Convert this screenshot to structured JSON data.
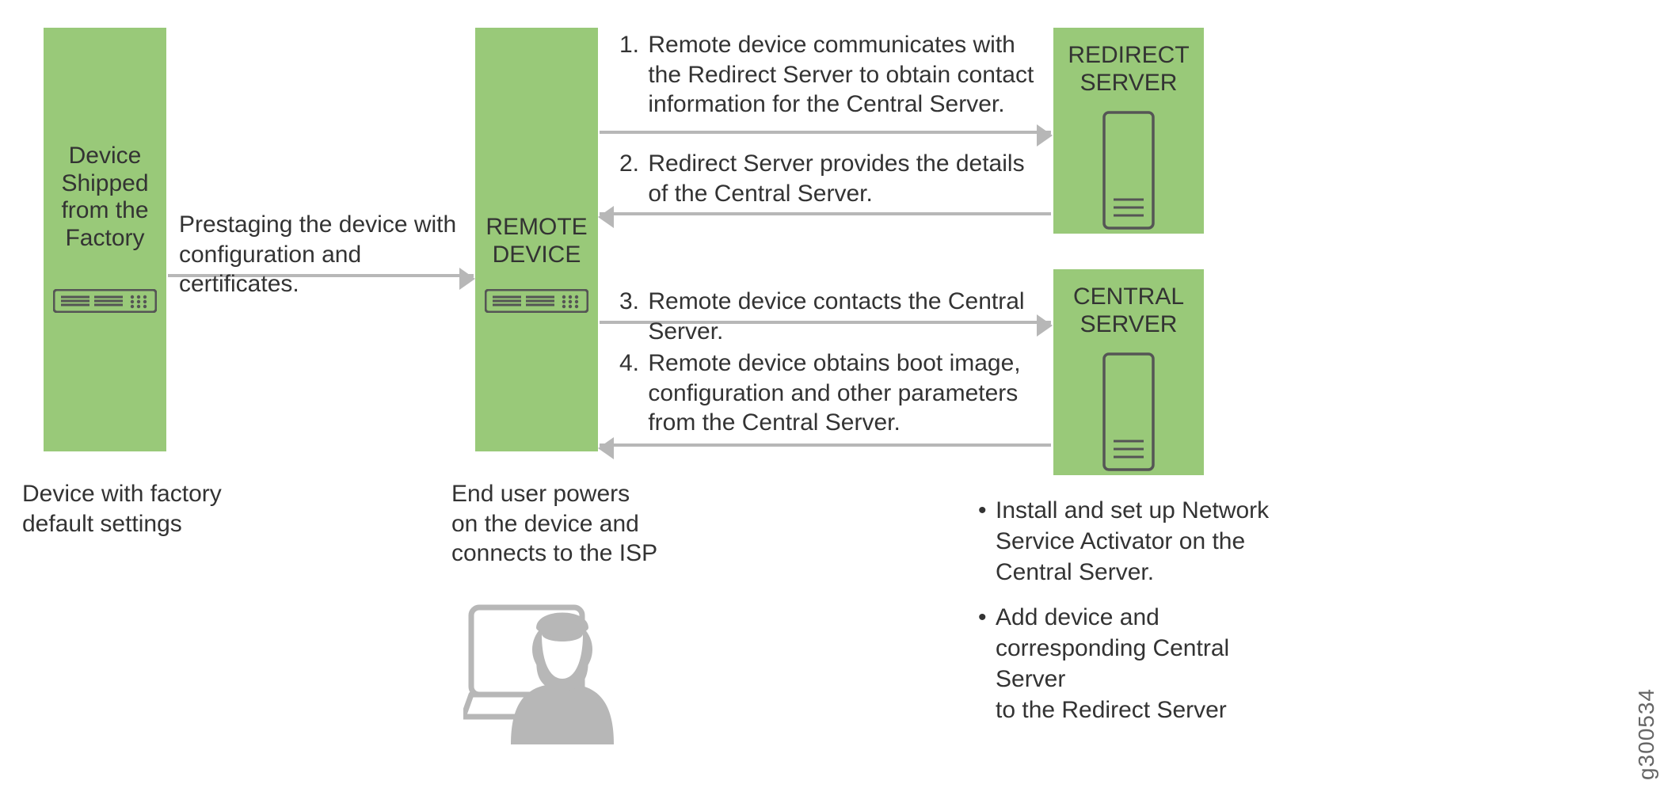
{
  "boxes": {
    "factory": {
      "title": "Device\nShipped\nfrom the\nFactory"
    },
    "remote": {
      "title": "REMOTE\nDEVICE"
    },
    "redirect": {
      "title": "REDIRECT\nSERVER"
    },
    "central": {
      "title": "CENTRAL\nSERVER"
    }
  },
  "captions": {
    "factory_below": "Device with factory\ndefault settings",
    "remote_below": "End user powers\non the device and\nconnects to the ISP",
    "prestage": "Prestaging the device with\nconfiguration and certificates."
  },
  "steps": {
    "s1": "Remote device communicates with\nthe Redirect Server to obtain contact\ninformation for the Central Server.",
    "s2": "Redirect Server provides the details\nof the Central Server.",
    "s3": "Remote device contacts the Central Server.",
    "s4": "Remote device obtains boot image,\nconfiguration and other parameters\nfrom the Central Server."
  },
  "step_nums": {
    "n1": "1.",
    "n2": "2.",
    "n3": "3.",
    "n4": "4."
  },
  "bullets": {
    "b1": "Install and set up Network\nService Activator on the\nCentral Server.",
    "b2": "Add device and\ncorresponding Central Server\nto the Redirect Server"
  },
  "figure_id": "g300534",
  "colors": {
    "box_fill": "#99c979",
    "arrow": "#b7b7b7",
    "text": "#333333"
  }
}
